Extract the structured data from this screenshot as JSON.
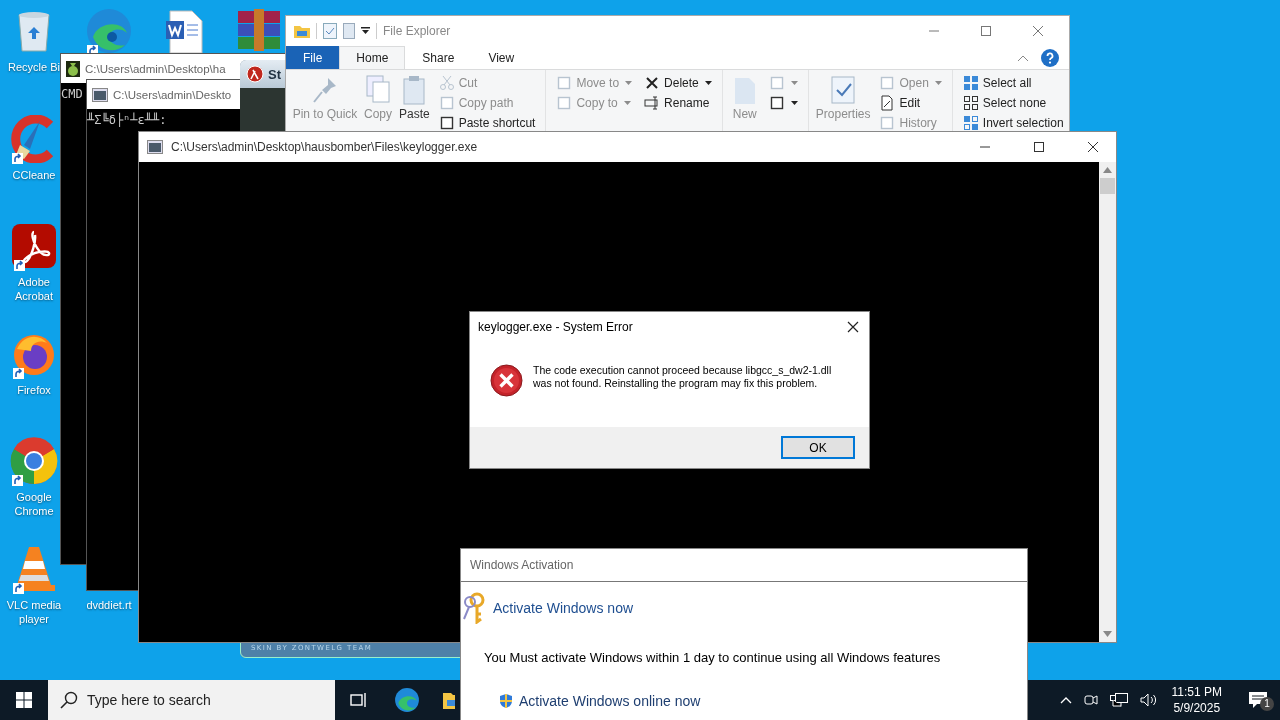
{
  "desktop_icons": [
    {
      "kind": "recycle-bin",
      "label": "Recycle Bi",
      "shortcut": false
    },
    {
      "kind": "edge",
      "shortcut": true
    },
    {
      "kind": "word",
      "shortcut": false
    },
    {
      "kind": "winrar",
      "shortcut": false
    },
    {
      "kind": "ccleaner",
      "label": "CCleane",
      "shortcut": true
    },
    {
      "kind": "acrobat",
      "label": "Adobe Acrobat",
      "shortcut": true
    },
    {
      "kind": "firefox",
      "label": "Firefox",
      "shortcut": true
    },
    {
      "kind": "chrome",
      "label": "Google Chrome",
      "shortcut": true
    },
    {
      "kind": "vlc",
      "label": "VLC media player",
      "shortcut": true
    },
    {
      "kind": "document",
      "label": "dvddiet.rt",
      "shortcut": false
    }
  ],
  "cmd_windows": [
    {
      "kind": "bag",
      "title": "C:\\Users\\admin\\Desktop\\ha",
      "console_text": "CMD"
    },
    {
      "kind": "console",
      "title": "C:\\Users\\admin\\Deskto",
      "console_text": "╨Σ╚δ├ⁿ┴ε╨╨:"
    }
  ],
  "skin_window": {
    "title": "St",
    "footer": "SKIN BY ZONTWELG TEAM"
  },
  "file_explorer": {
    "title": "File Explorer",
    "tabs": [
      {
        "label": "File",
        "kind": "file",
        "selected": false
      },
      {
        "label": "Home",
        "kind": "tab",
        "selected": true
      },
      {
        "label": "Share",
        "kind": "tab",
        "selected": false
      },
      {
        "label": "View",
        "kind": "tab",
        "selected": false
      }
    ],
    "ribbon_groups": [
      {
        "columns": [
          {
            "kind": "large",
            "items": [
              {
                "kind": "pin",
                "label": "Pin to Quick",
                "disabled": true
              }
            ]
          },
          {
            "kind": "large",
            "items": [
              {
                "kind": "copy",
                "label": "Copy",
                "disabled": true
              }
            ]
          },
          {
            "kind": "large",
            "items": [
              {
                "kind": "paste",
                "label": "Paste",
                "disabled": false
              }
            ]
          },
          {
            "kind": "small",
            "items": [
              {
                "kind": "cut",
                "label": "Cut",
                "disabled": true,
                "dropdown": false
              },
              {
                "kind": "copy-path",
                "label": "Copy path",
                "disabled": true,
                "dropdown": false
              },
              {
                "kind": "paste-shortcut",
                "label": "Paste shortcut",
                "disabled": false,
                "dropdown": false
              }
            ]
          }
        ]
      },
      {
        "columns": [
          {
            "kind": "small",
            "items": [
              {
                "kind": "move",
                "label": "Move to",
                "disabled": true,
                "dropdown": true
              },
              {
                "kind": "copy-to",
                "label": "Copy to",
                "disabled": true,
                "dropdown": true
              }
            ]
          },
          {
            "kind": "small",
            "items": [
              {
                "kind": "delete",
                "label": "Delete",
                "disabled": false,
                "dropdown": true
              },
              {
                "kind": "rename",
                "label": "Rename",
                "disabled": false,
                "dropdown": false
              }
            ]
          }
        ]
      },
      {
        "columns": [
          {
            "kind": "large",
            "items": [
              {
                "kind": "new-folder",
                "label": "New",
                "disabled": true
              }
            ]
          },
          {
            "kind": "small",
            "items": [
              {
                "kind": "new-item",
                "disabled": true,
                "dropdown": true
              },
              {
                "kind": "easy-access",
                "disabled": false,
                "dropdown": true
              }
            ]
          }
        ]
      },
      {
        "columns": [
          {
            "kind": "large",
            "items": [
              {
                "kind": "properties",
                "label": "Properties",
                "disabled": true
              }
            ]
          },
          {
            "kind": "small",
            "items": [
              {
                "kind": "open",
                "label": "Open",
                "disabled": true,
                "dropdown": true
              },
              {
                "kind": "edit",
                "label": "Edit",
                "disabled": false,
                "dropdown": false
              },
              {
                "kind": "history",
                "label": "History",
                "disabled": true,
                "dropdown": false
              }
            ]
          }
        ]
      },
      {
        "columns": [
          {
            "kind": "small",
            "items": [
              {
                "kind": "select-all",
                "label": "Select all",
                "disabled": false,
                "dropdown": false
              },
              {
                "kind": "select-none",
                "label": "Select none",
                "disabled": false,
                "dropdown": false
              },
              {
                "kind": "invert",
                "label": "Invert selection",
                "disabled": false,
                "dropdown": false
              }
            ]
          }
        ]
      }
    ]
  },
  "console_window": {
    "title": "C:\\Users\\admin\\Desktop\\hausbomber\\Files\\keylogger.exe"
  },
  "error_dialog": {
    "title": "keylogger.exe - System Error",
    "message": "The code execution cannot proceed because libgcc_s_dw2-1.dll was not found. Reinstalling the program may fix this problem.",
    "button": "OK"
  },
  "activation_window": {
    "title": "Windows Activation",
    "heading": "Activate Windows now",
    "message": "You Must activate Windows within 1 day to continue using all Windows features",
    "link": "Activate Windows online now"
  },
  "taskbar": {
    "search_placeholder": "Type here to search",
    "apps": [
      {
        "kind": "task-view"
      },
      {
        "kind": "edge"
      },
      {
        "kind": "explorer"
      }
    ],
    "time": "11:51 PM",
    "date": "5/9/2025",
    "notification_count": "1"
  }
}
